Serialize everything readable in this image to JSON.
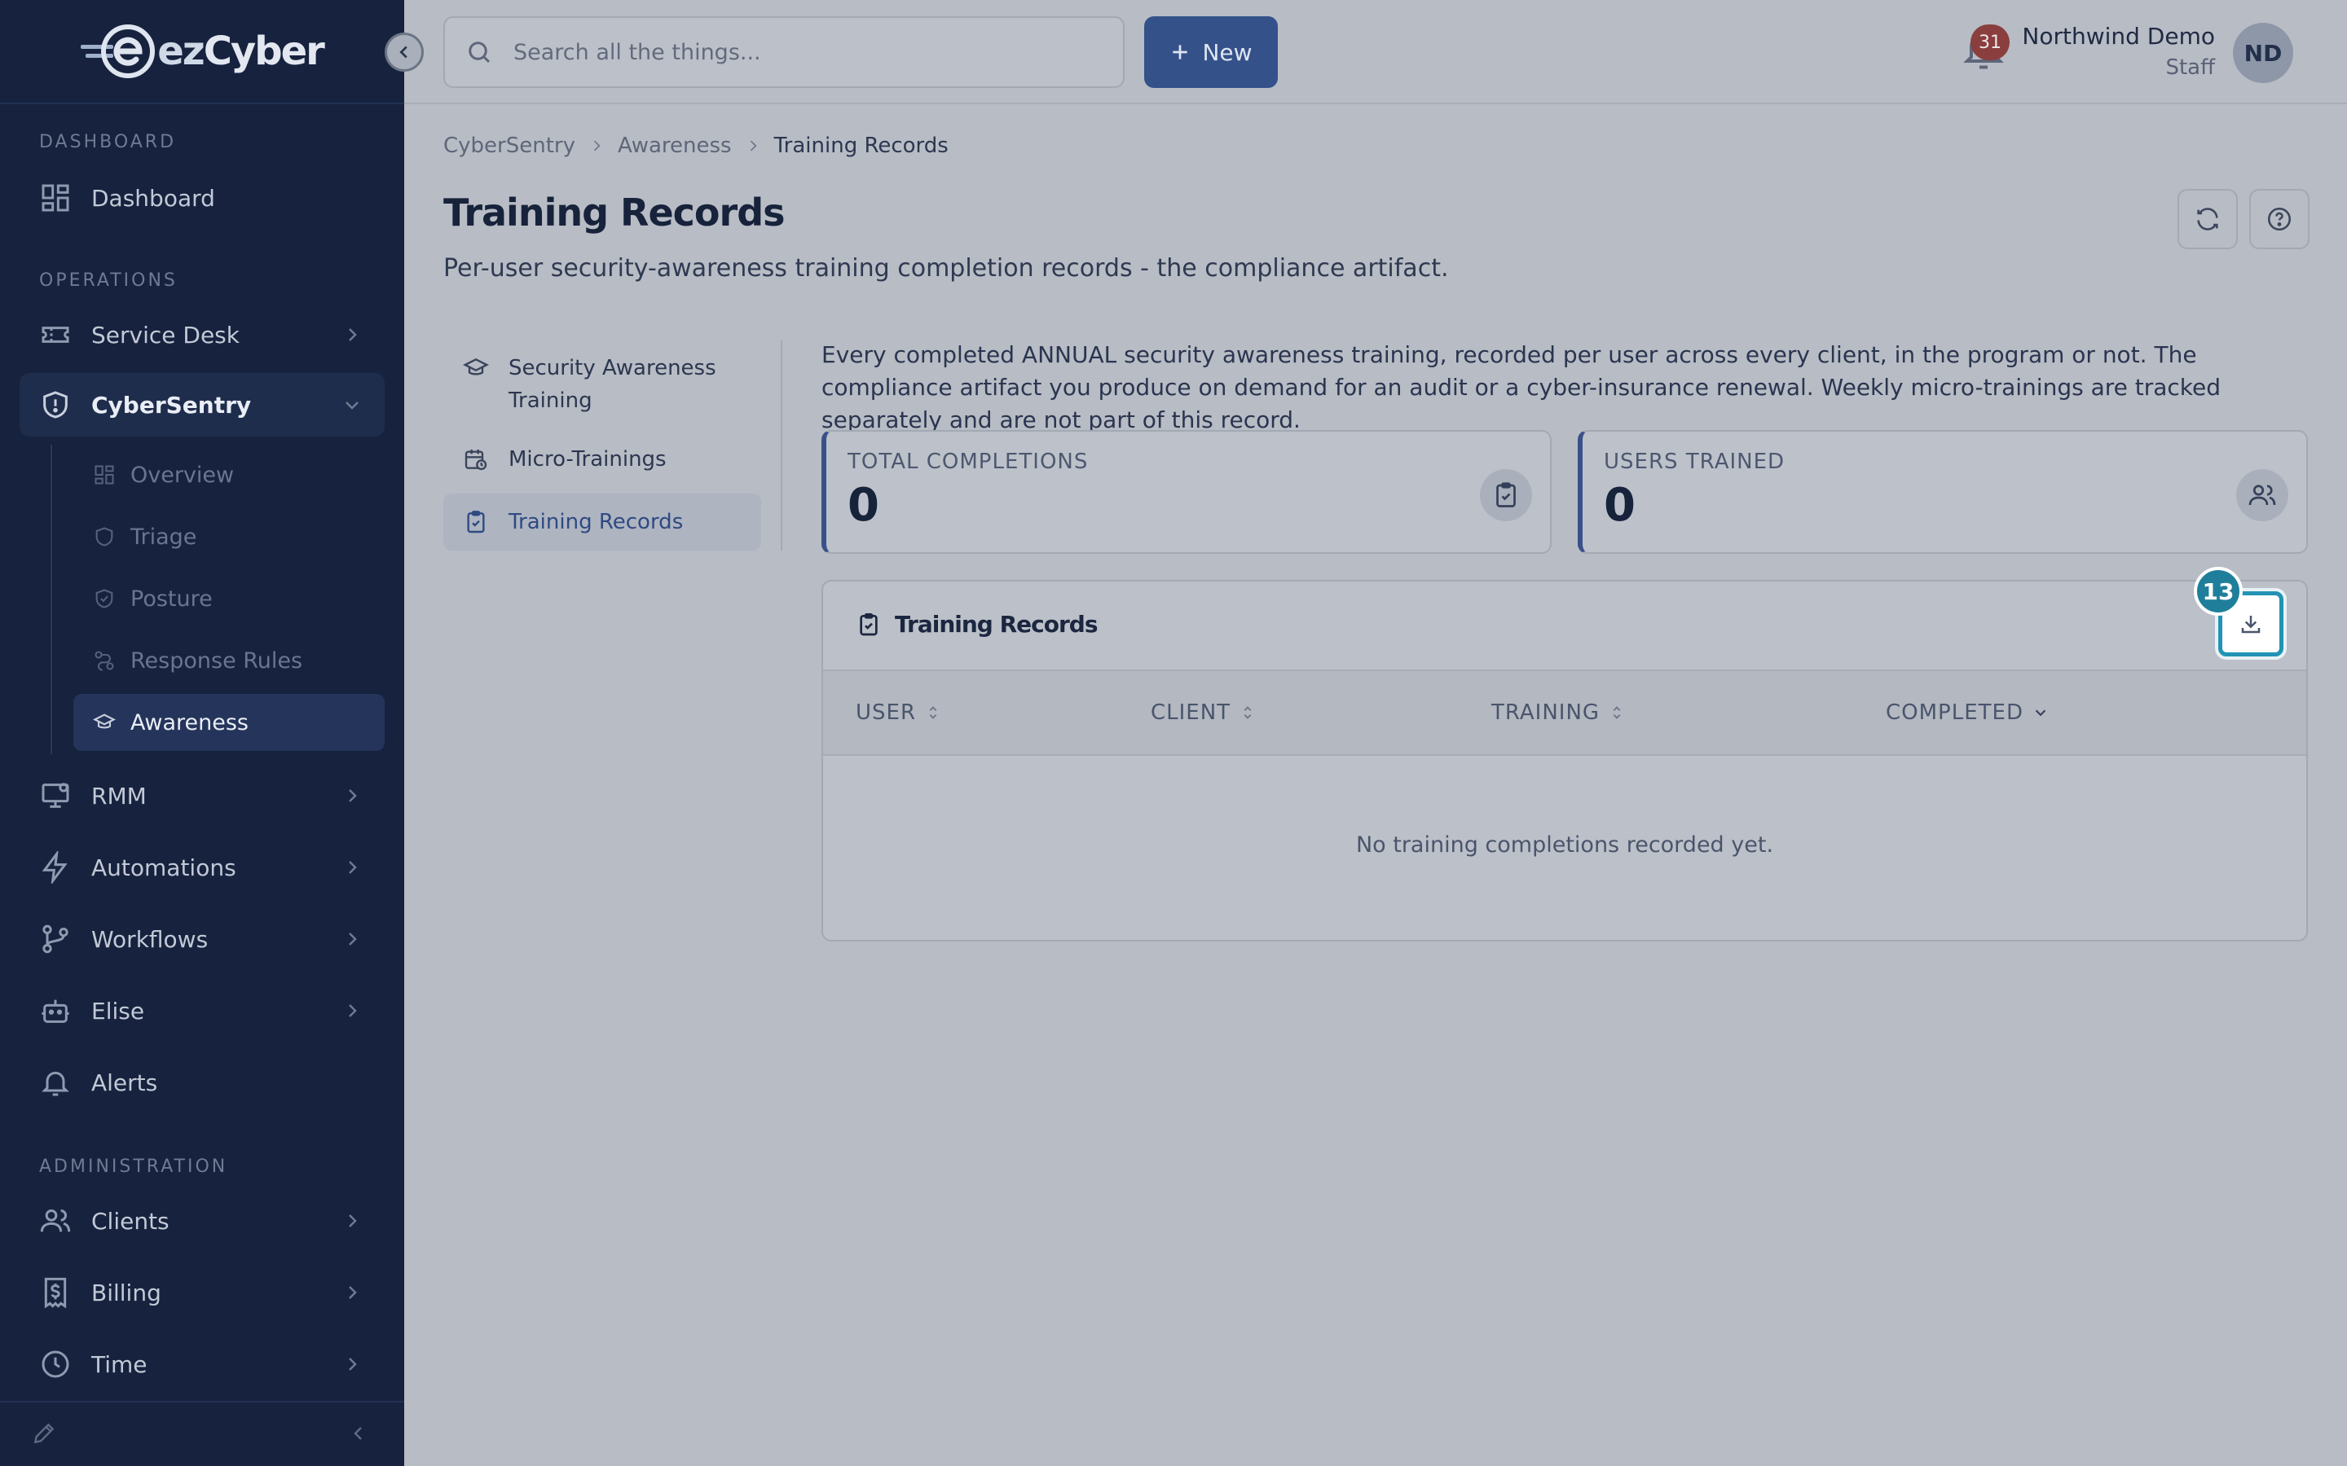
{
  "brand": {
    "name_prefix": "ez",
    "name_suffix": "Cyber"
  },
  "sidebar": {
    "sections": [
      "DASHBOARD",
      "OPERATIONS",
      "ADMINISTRATION"
    ],
    "items": [
      {
        "label": "Dashboard",
        "icon": "dashboard-icon"
      },
      {
        "label": "Service Desk",
        "icon": "ticket-icon"
      },
      {
        "label": "CyberSentry",
        "icon": "shield-icon"
      },
      {
        "label": "RMM",
        "icon": "monitor-icon"
      },
      {
        "label": "Automations",
        "icon": "bolt-icon"
      },
      {
        "label": "Workflows",
        "icon": "git-branch-icon"
      },
      {
        "label": "Elise",
        "icon": "bot-icon"
      },
      {
        "label": "Alerts",
        "icon": "bell-icon"
      },
      {
        "label": "Clients",
        "icon": "users-icon"
      },
      {
        "label": "Billing",
        "icon": "receipt-icon"
      },
      {
        "label": "Time",
        "icon": "clock-icon"
      }
    ],
    "sub_items": [
      {
        "label": "Overview",
        "icon": "grid-icon"
      },
      {
        "label": "Triage",
        "icon": "shield-icon"
      },
      {
        "label": "Posture",
        "icon": "shield-check-icon"
      },
      {
        "label": "Response Rules",
        "icon": "route-icon"
      },
      {
        "label": "Awareness",
        "icon": "graduation-cap-icon"
      }
    ]
  },
  "topbar": {
    "search_placeholder": "Search all the things...",
    "new_label": "New",
    "notification_count": "31",
    "user_name": "Northwind Demo",
    "user_role": "Staff",
    "avatar_initials": "ND"
  },
  "breadcrumb": [
    "CyberSentry",
    "Awareness",
    "Training Records"
  ],
  "page": {
    "title": "Training Records",
    "subtitle": "Per-user security-awareness training completion records - the compliance artifact."
  },
  "subnav": [
    {
      "label": "Security Awareness Training",
      "icon": "graduation-cap-icon"
    },
    {
      "label": "Micro-Trainings",
      "icon": "calendar-clock-icon"
    },
    {
      "label": "Training Records",
      "icon": "clipboard-check-icon"
    }
  ],
  "intro": "Every completed ANNUAL security awareness training, recorded per user across every client, in the program or not. The compliance artifact you produce on demand for an audit or a cyber-insurance renewal. Weekly micro-trainings are tracked separately and are not part of this record.",
  "stats": [
    {
      "label": "TOTAL COMPLETIONS",
      "value": "0",
      "icon": "clipboard-check-icon"
    },
    {
      "label": "USERS TRAINED",
      "value": "0",
      "icon": "users-icon"
    }
  ],
  "table": {
    "title": "Training Records",
    "columns": [
      "USER",
      "CLIENT",
      "TRAINING",
      "COMPLETED"
    ],
    "empty_message": "No training completions recorded yet."
  },
  "annotation": {
    "step": "13"
  },
  "colors": {
    "accent": "#34518a",
    "highlight": "#2293b4",
    "sidebar_bg": "#16223e"
  }
}
